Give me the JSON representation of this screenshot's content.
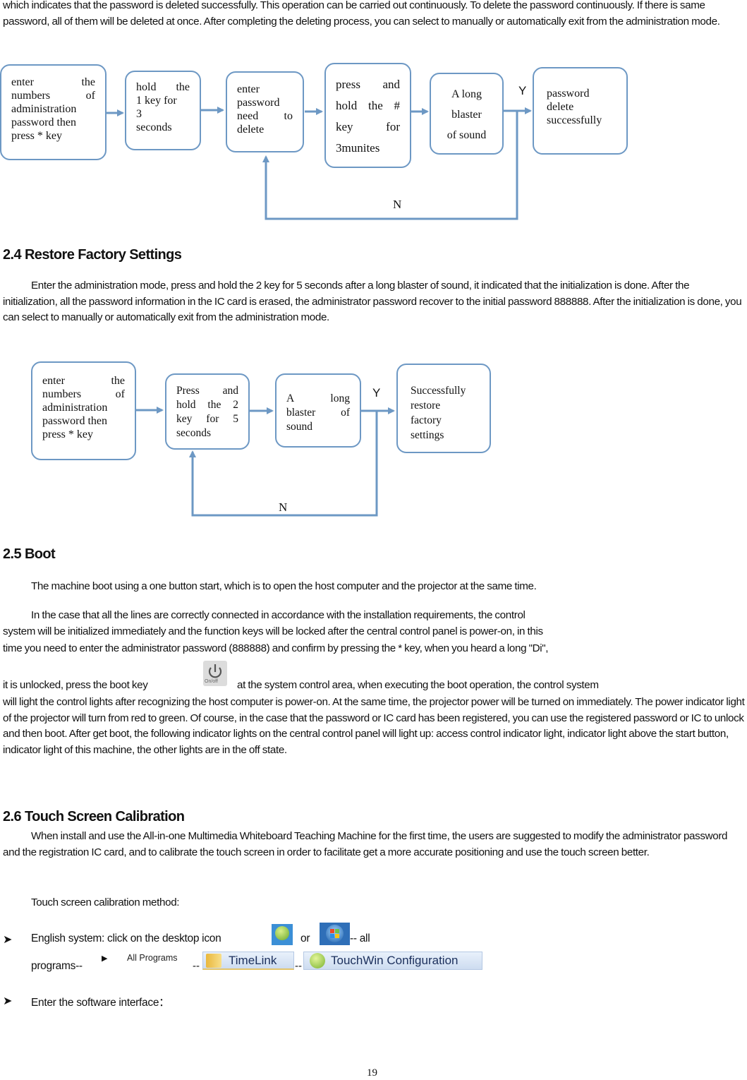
{
  "intro_paragraph": "which indicates that the password is deleted successfully. This operation can be carried out continuously. To delete the password continuously. If there is same password, all of them will be deleted at once. After completing the deleting process, you can select to manually or automatically exit from the administration mode.",
  "flow1": {
    "steps": [
      [
        "enter the",
        "numbers of",
        "administration",
        "password then",
        "press * key"
      ],
      [
        "hold the",
        "1 key for",
        "3",
        "seconds"
      ],
      [
        "enter",
        "password",
        "need to",
        "delete"
      ],
      [
        "press and",
        "hold the #",
        "key for",
        "3munites"
      ],
      [
        "A long",
        "blaster",
        "of sound"
      ],
      [
        "password",
        "delete",
        "successfully"
      ]
    ],
    "yes_label": "Y",
    "no_label": "N"
  },
  "section_2_4": {
    "heading": "2.4 Restore Factory Settings",
    "body": "Enter the administration mode, press and hold the 2 key for 5 seconds after a long blaster of sound, it indicated that the initialization is done. After the initialization, all the password information in the IC card is erased, the administrator password recover to the initial password 888888. After the initialization is done, you can select to manually or automatically exit from the administration mode."
  },
  "flow2": {
    "steps": [
      [
        "enter the",
        "numbers of",
        "administration",
        "password then",
        "press * key"
      ],
      [
        "Press and",
        "hold the 2",
        "key for 5",
        "seconds"
      ],
      [
        "A long",
        "blaster of",
        "sound"
      ],
      [
        "Successfully",
        "restore",
        "factory",
        "settings"
      ]
    ],
    "yes_label": "Y",
    "no_label": "N"
  },
  "section_2_5": {
    "heading": "2.5 Boot",
    "para1": "The machine boot using a one button start, which is to open the host computer and the projector at the same time.",
    "para2_line1": "In the case that all the lines are correctly connected in accordance with the installation requirements, the control",
    "para2_line2": "system will be initialized immediately and the function keys will be locked after the central control panel is power-on, in this",
    "para2_line3": "time you need to enter the administrator password (888888) and confirm by pressing the * key, when you heard a long \"Di\",",
    "para2_line4a": "it is unlocked, press the boot key",
    "power_icon_label": "On/off",
    "para2_line4b": "at the system control area, when executing the boot operation, the control system",
    "para2_rest": "will light the control lights   after recognizing the host computer is power-on. At the same time, the projector power will be turned on immediately. The power indicator light of the projector will turn from red to green. Of course, in the case that the password or IC card has been registered, you can use the registered password or IC to unlock and then boot. After get boot, the following indicator lights on the central control panel will light up: access control indicator light, indicator light above the start button, indicator light of this machine, the other lights are in the off state."
  },
  "section_2_6": {
    "heading": "2.6 Touch Screen Calibration",
    "body": "When install and use the All-in-one Multimedia Whiteboard Teaching Machine for the first time, the users are suggested to modify the administrator password and the registration IC card, and to calibrate the touch screen in order to facilitate get a more accurate positioning and use the touch screen better.",
    "method_label": "Touch screen calibration method:",
    "bullet1_a": "English system: click on the desktop icon",
    "bullet1_or": "or",
    "bullet1_b": "-- all",
    "bullet1_line2": "programs--",
    "all_programs_label": "All Programs",
    "sep": "--",
    "timelink_label": "TimeLink",
    "touchwin_label": "TouchWin Configuration",
    "bullet2": "Enter the software interface："
  },
  "page_number": "19",
  "colors": {
    "flow_stroke": "#6d98c4"
  }
}
